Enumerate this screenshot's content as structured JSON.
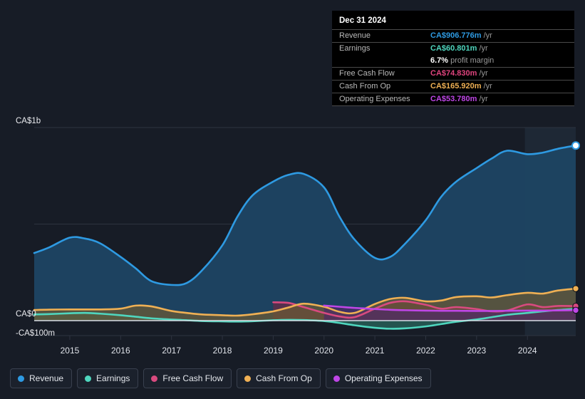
{
  "chart_data": {
    "type": "area",
    "title": "",
    "xlabel": "",
    "ylabel": "",
    "currency": "CA$",
    "grid": true,
    "legend_position": "bottom",
    "x": [
      2014.3,
      2014.6,
      2015.0,
      2015.3,
      2015.6,
      2016.0,
      2016.3,
      2016.6,
      2017.0,
      2017.3,
      2017.6,
      2018.0,
      2018.3,
      2018.6,
      2019.0,
      2019.3,
      2019.6,
      2020.0,
      2020.3,
      2020.6,
      2021.0,
      2021.3,
      2021.6,
      2022.0,
      2022.3,
      2022.6,
      2023.0,
      2023.3,
      2023.6,
      2024.0,
      2024.3,
      2024.6,
      2024.95
    ],
    "xlim": [
      2014.3,
      2024.95
    ],
    "ylim": [
      -100,
      1000
    ],
    "ytick_values": [
      1000,
      500,
      0,
      -100
    ],
    "ytick_labels": [
      "CA$1b",
      "",
      "CA$0",
      "-CA$100m"
    ],
    "xtick_labels": [
      "2015",
      "2016",
      "2017",
      "2018",
      "2019",
      "2020",
      "2021",
      "2022",
      "2023",
      "2024"
    ],
    "forecast_start_x": 2023.95,
    "series": [
      {
        "name": "Revenue",
        "color": "#2e9ae2",
        "fill": "#1d4463",
        "end_value_label": "CA$906.776m",
        "values": [
          350,
          380,
          430,
          425,
          400,
          330,
          270,
          205,
          185,
          195,
          260,
          390,
          540,
          650,
          720,
          755,
          760,
          690,
          540,
          420,
          325,
          330,
          400,
          520,
          640,
          720,
          790,
          840,
          880,
          862,
          870,
          890,
          907
        ]
      },
      {
        "name": "Earnings",
        "color": "#4fd6be",
        "fill": "#2a6b60",
        "end_value_label": "CA$60.801m",
        "values": [
          32,
          34,
          38,
          40,
          36,
          28,
          20,
          12,
          6,
          2,
          -2,
          -4,
          -5,
          -3,
          2,
          4,
          3,
          -2,
          -12,
          -24,
          -37,
          -42,
          -40,
          -30,
          -18,
          -6,
          6,
          18,
          30,
          40,
          48,
          55,
          61
        ]
      },
      {
        "name": "Free Cash Flow",
        "color": "#d84a7f",
        "fill": "#6b2a45",
        "start_x": 2019.0,
        "end_value_label": "CA$74.830m",
        "values": [
          null,
          null,
          null,
          null,
          null,
          null,
          null,
          null,
          null,
          null,
          null,
          null,
          null,
          null,
          95,
          92,
          70,
          40,
          22,
          18,
          62,
          92,
          100,
          82,
          62,
          70,
          60,
          48,
          52,
          84,
          70,
          76,
          75
        ]
      },
      {
        "name": "Cash From Op",
        "color": "#efb054",
        "fill": "#6b5a33",
        "end_value_label": "CA$165.920m",
        "values": [
          55,
          57,
          58,
          58,
          58,
          62,
          78,
          74,
          50,
          40,
          32,
          28,
          26,
          33,
          48,
          68,
          88,
          72,
          46,
          40,
          86,
          112,
          118,
          100,
          104,
          122,
          126,
          120,
          132,
          144,
          140,
          156,
          166
        ]
      },
      {
        "name": "Operating Expenses",
        "color": "#bf46e6",
        "fill": "#4e2a66",
        "start_x": 2020.0,
        "end_value_label": "CA$53.780m",
        "values": [
          null,
          null,
          null,
          null,
          null,
          null,
          null,
          null,
          null,
          null,
          null,
          null,
          null,
          null,
          null,
          null,
          null,
          78,
          72,
          66,
          60,
          56,
          54,
          52,
          51,
          51,
          50,
          50,
          51,
          52,
          52,
          53,
          54
        ]
      }
    ]
  },
  "tooltip": {
    "date": "Dec 31 2024",
    "unit_suffix": "/yr",
    "rows": [
      {
        "label": "Revenue",
        "value": "CA$906.776m",
        "color": "#2e9ae2"
      },
      {
        "label": "Earnings",
        "value": "CA$60.801m",
        "color": "#4fd6be"
      },
      {
        "label": "Free Cash Flow",
        "value": "CA$74.830m",
        "color": "#e0447e"
      },
      {
        "label": "Cash From Op",
        "value": "CA$165.920m",
        "color": "#efb054"
      },
      {
        "label": "Operating Expenses",
        "value": "CA$53.780m",
        "color": "#bf46e6"
      }
    ],
    "margin_pct": "6.7%",
    "margin_text": "profit margin"
  },
  "legend": {
    "items": [
      {
        "label": "Revenue",
        "color": "#2e9ae2"
      },
      {
        "label": "Earnings",
        "color": "#4fd6be"
      },
      {
        "label": "Free Cash Flow",
        "color": "#d84a7f"
      },
      {
        "label": "Cash From Op",
        "color": "#efb054"
      },
      {
        "label": "Operating Expenses",
        "color": "#bf46e6"
      }
    ]
  },
  "theme": {
    "background": "#171c26",
    "grid_color": "#2e3440",
    "zero_line_color": "#d8dde6",
    "forecast_band": "#1e2835"
  }
}
